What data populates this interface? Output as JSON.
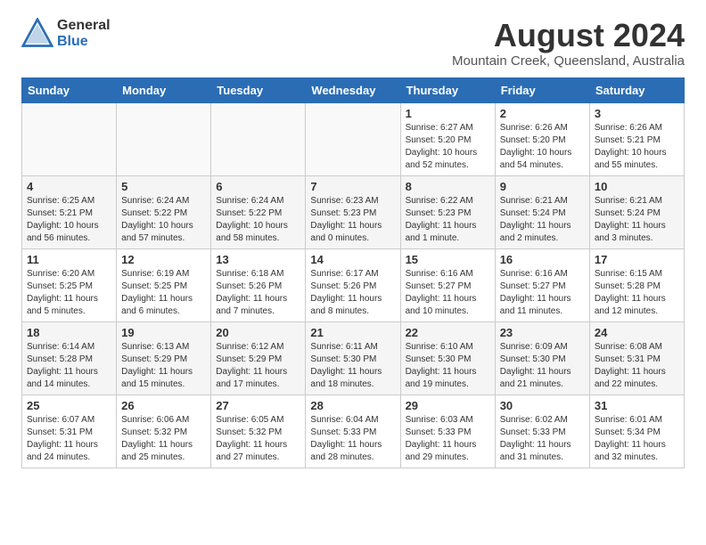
{
  "logo": {
    "general": "General",
    "blue": "Blue"
  },
  "title": "August 2024",
  "subtitle": "Mountain Creek, Queensland, Australia",
  "calendar": {
    "headers": [
      "Sunday",
      "Monday",
      "Tuesday",
      "Wednesday",
      "Thursday",
      "Friday",
      "Saturday"
    ],
    "weeks": [
      [
        {
          "day": "",
          "info": ""
        },
        {
          "day": "",
          "info": ""
        },
        {
          "day": "",
          "info": ""
        },
        {
          "day": "",
          "info": ""
        },
        {
          "day": "1",
          "info": "Sunrise: 6:27 AM\nSunset: 5:20 PM\nDaylight: 10 hours\nand 52 minutes."
        },
        {
          "day": "2",
          "info": "Sunrise: 6:26 AM\nSunset: 5:20 PM\nDaylight: 10 hours\nand 54 minutes."
        },
        {
          "day": "3",
          "info": "Sunrise: 6:26 AM\nSunset: 5:21 PM\nDaylight: 10 hours\nand 55 minutes."
        }
      ],
      [
        {
          "day": "4",
          "info": "Sunrise: 6:25 AM\nSunset: 5:21 PM\nDaylight: 10 hours\nand 56 minutes."
        },
        {
          "day": "5",
          "info": "Sunrise: 6:24 AM\nSunset: 5:22 PM\nDaylight: 10 hours\nand 57 minutes."
        },
        {
          "day": "6",
          "info": "Sunrise: 6:24 AM\nSunset: 5:22 PM\nDaylight: 10 hours\nand 58 minutes."
        },
        {
          "day": "7",
          "info": "Sunrise: 6:23 AM\nSunset: 5:23 PM\nDaylight: 11 hours\nand 0 minutes."
        },
        {
          "day": "8",
          "info": "Sunrise: 6:22 AM\nSunset: 5:23 PM\nDaylight: 11 hours\nand 1 minute."
        },
        {
          "day": "9",
          "info": "Sunrise: 6:21 AM\nSunset: 5:24 PM\nDaylight: 11 hours\nand 2 minutes."
        },
        {
          "day": "10",
          "info": "Sunrise: 6:21 AM\nSunset: 5:24 PM\nDaylight: 11 hours\nand 3 minutes."
        }
      ],
      [
        {
          "day": "11",
          "info": "Sunrise: 6:20 AM\nSunset: 5:25 PM\nDaylight: 11 hours\nand 5 minutes."
        },
        {
          "day": "12",
          "info": "Sunrise: 6:19 AM\nSunset: 5:25 PM\nDaylight: 11 hours\nand 6 minutes."
        },
        {
          "day": "13",
          "info": "Sunrise: 6:18 AM\nSunset: 5:26 PM\nDaylight: 11 hours\nand 7 minutes."
        },
        {
          "day": "14",
          "info": "Sunrise: 6:17 AM\nSunset: 5:26 PM\nDaylight: 11 hours\nand 8 minutes."
        },
        {
          "day": "15",
          "info": "Sunrise: 6:16 AM\nSunset: 5:27 PM\nDaylight: 11 hours\nand 10 minutes."
        },
        {
          "day": "16",
          "info": "Sunrise: 6:16 AM\nSunset: 5:27 PM\nDaylight: 11 hours\nand 11 minutes."
        },
        {
          "day": "17",
          "info": "Sunrise: 6:15 AM\nSunset: 5:28 PM\nDaylight: 11 hours\nand 12 minutes."
        }
      ],
      [
        {
          "day": "18",
          "info": "Sunrise: 6:14 AM\nSunset: 5:28 PM\nDaylight: 11 hours\nand 14 minutes."
        },
        {
          "day": "19",
          "info": "Sunrise: 6:13 AM\nSunset: 5:29 PM\nDaylight: 11 hours\nand 15 minutes."
        },
        {
          "day": "20",
          "info": "Sunrise: 6:12 AM\nSunset: 5:29 PM\nDaylight: 11 hours\nand 17 minutes."
        },
        {
          "day": "21",
          "info": "Sunrise: 6:11 AM\nSunset: 5:30 PM\nDaylight: 11 hours\nand 18 minutes."
        },
        {
          "day": "22",
          "info": "Sunrise: 6:10 AM\nSunset: 5:30 PM\nDaylight: 11 hours\nand 19 minutes."
        },
        {
          "day": "23",
          "info": "Sunrise: 6:09 AM\nSunset: 5:30 PM\nDaylight: 11 hours\nand 21 minutes."
        },
        {
          "day": "24",
          "info": "Sunrise: 6:08 AM\nSunset: 5:31 PM\nDaylight: 11 hours\nand 22 minutes."
        }
      ],
      [
        {
          "day": "25",
          "info": "Sunrise: 6:07 AM\nSunset: 5:31 PM\nDaylight: 11 hours\nand 24 minutes."
        },
        {
          "day": "26",
          "info": "Sunrise: 6:06 AM\nSunset: 5:32 PM\nDaylight: 11 hours\nand 25 minutes."
        },
        {
          "day": "27",
          "info": "Sunrise: 6:05 AM\nSunset: 5:32 PM\nDaylight: 11 hours\nand 27 minutes."
        },
        {
          "day": "28",
          "info": "Sunrise: 6:04 AM\nSunset: 5:33 PM\nDaylight: 11 hours\nand 28 minutes."
        },
        {
          "day": "29",
          "info": "Sunrise: 6:03 AM\nSunset: 5:33 PM\nDaylight: 11 hours\nand 29 minutes."
        },
        {
          "day": "30",
          "info": "Sunrise: 6:02 AM\nSunset: 5:33 PM\nDaylight: 11 hours\nand 31 minutes."
        },
        {
          "day": "31",
          "info": "Sunrise: 6:01 AM\nSunset: 5:34 PM\nDaylight: 11 hours\nand 32 minutes."
        }
      ]
    ]
  }
}
